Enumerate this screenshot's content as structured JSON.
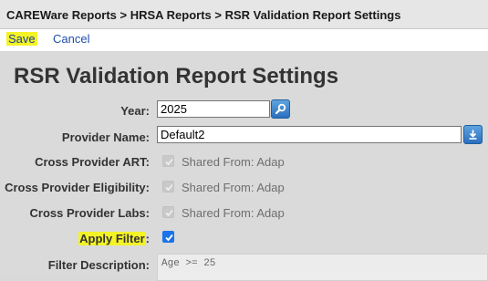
{
  "breadcrumb": "CAREWare Reports > HRSA Reports > RSR Validation Report Settings",
  "toolbar": {
    "save_label": "Save",
    "cancel_label": "Cancel"
  },
  "page_title": "RSR Validation Report Settings",
  "fields": {
    "year": {
      "label": "Year:",
      "value": "2025",
      "icon": "search-icon"
    },
    "provider_name": {
      "label": "Provider Name:",
      "value": "Default2",
      "icon": "download-icon"
    },
    "cross_provider_art": {
      "label": "Cross Provider ART:",
      "checked": true,
      "disabled": true,
      "shared_text": "Shared From: Adap"
    },
    "cross_provider_eligibility": {
      "label": "Cross Provider Eligibility:",
      "checked": true,
      "disabled": true,
      "shared_text": "Shared From: Adap"
    },
    "cross_provider_labs": {
      "label": "Cross Provider Labs:",
      "checked": true,
      "disabled": true,
      "shared_text": "Shared From: Adap"
    },
    "apply_filter": {
      "label": "Apply Filter",
      "label_suffix": ":",
      "checked": true
    },
    "filter_description": {
      "label": "Filter Description:",
      "value": "Age >= 25"
    }
  },
  "colors": {
    "highlight": "#f3f326",
    "accent": "#1a73e8",
    "link": "#1f4ea8"
  }
}
